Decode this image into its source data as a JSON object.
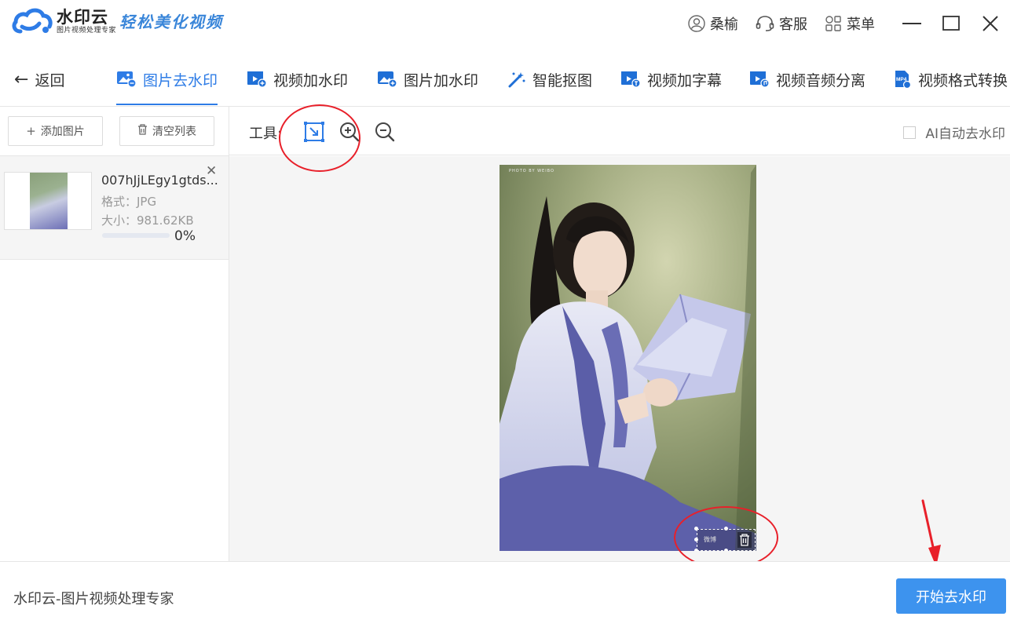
{
  "app": {
    "name": "水印云",
    "subtitle": "图片视频处理专家",
    "slogan": "轻松美化视频",
    "brand_color": "#2e7ce6"
  },
  "titlebar": {
    "user_label": "桑榆",
    "service_label": "客服",
    "menu_label": "菜单",
    "icons": [
      "user-icon",
      "headset-icon",
      "grid-menu-icon",
      "minimize-icon",
      "maximize-icon",
      "close-icon"
    ]
  },
  "nav": {
    "back_label": "返回",
    "tabs": [
      {
        "label": "图片去水印",
        "icon": "image-remove-icon",
        "active": true
      },
      {
        "label": "视频加水印",
        "icon": "video-add-icon",
        "active": false
      },
      {
        "label": "图片加水印",
        "icon": "image-add-icon",
        "active": false
      },
      {
        "label": "智能抠图",
        "icon": "magic-wand-icon",
        "active": false
      },
      {
        "label": "视频加字幕",
        "icon": "video-subtitle-icon",
        "active": false
      },
      {
        "label": "视频音频分离",
        "icon": "video-audio-icon",
        "active": false
      },
      {
        "label": "视频格式转换",
        "icon": "mp4-icon",
        "active": false
      }
    ]
  },
  "sidebar": {
    "add_button": "添加图片",
    "clear_button": "清空列表",
    "files": [
      {
        "name": "007hJjLEgy1gtds...",
        "format_label": "格式：JPG",
        "size_label": "大小：981.62KB",
        "progress": 0,
        "progress_text": "0%"
      }
    ]
  },
  "toolbar": {
    "label": "工具:",
    "tools": [
      "select-area-icon",
      "zoom-in-icon",
      "zoom-out-icon"
    ],
    "ai_checkbox_label": "AI自动去水印",
    "ai_checked": false
  },
  "canvas": {
    "photo_caption": "PHOTO BY WEIBO",
    "selection_watermark_text": "微博"
  },
  "footer": {
    "status_text": "水印云-图片视频处理专家",
    "start_button": "开始去水印"
  },
  "colors": {
    "accent": "#2e7ce6",
    "start_button": "#3d93ee",
    "annotation": "#e8202a"
  }
}
